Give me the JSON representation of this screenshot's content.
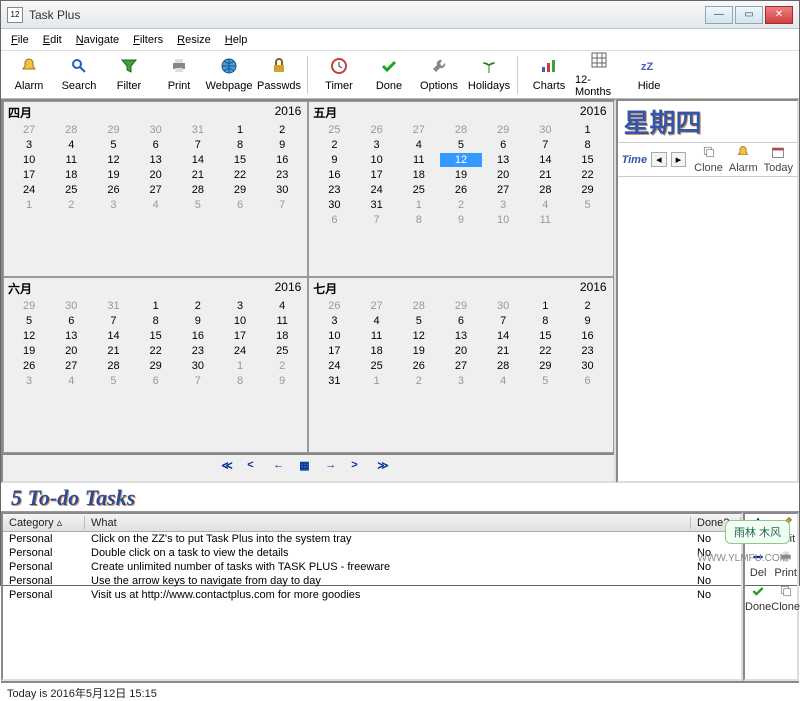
{
  "window": {
    "title": "Task Plus",
    "icon_text": "12"
  },
  "menubar": [
    "File",
    "Edit",
    "Navigate",
    "Filters",
    "Resize",
    "Help"
  ],
  "toolbar": [
    {
      "label": "Alarm",
      "icon": "bell"
    },
    {
      "label": "Search",
      "icon": "search"
    },
    {
      "label": "Filter",
      "icon": "filter"
    },
    {
      "label": "Print",
      "icon": "printer"
    },
    {
      "label": "Webpage",
      "icon": "globe"
    },
    {
      "label": "Passwds",
      "icon": "lock"
    },
    {
      "sep": true
    },
    {
      "label": "Timer",
      "icon": "clock"
    },
    {
      "label": "Done",
      "icon": "check"
    },
    {
      "label": "Options",
      "icon": "wrench"
    },
    {
      "label": "Holidays",
      "icon": "palm"
    },
    {
      "sep": true
    },
    {
      "label": "Charts",
      "icon": "chart"
    },
    {
      "label": "12-Months",
      "icon": "grid"
    },
    {
      "label": "Hide",
      "icon": "zz"
    }
  ],
  "calendars": [
    {
      "title": "四月",
      "year": "2016",
      "pre": [
        27,
        28,
        29,
        30,
        31
      ],
      "days": [
        1,
        2,
        3,
        4,
        5,
        6,
        7,
        8,
        9,
        10,
        11,
        12,
        13,
        14,
        15,
        16,
        17,
        18,
        19,
        20,
        21,
        22,
        23,
        24,
        25,
        26,
        27,
        28,
        29,
        30
      ],
      "post": [
        1,
        2,
        3,
        4,
        5,
        6,
        7
      ]
    },
    {
      "title": "五月",
      "year": "2016",
      "pre": [
        25,
        26,
        27,
        28,
        29,
        30
      ],
      "days": [
        1,
        2,
        3,
        4,
        5,
        6,
        7,
        8,
        9,
        10,
        11,
        12,
        13,
        14,
        15,
        16,
        17,
        18,
        19,
        20,
        21,
        22,
        23,
        24,
        25,
        26,
        27,
        28,
        29,
        30,
        31
      ],
      "post": [
        1,
        2,
        3,
        4,
        5,
        6,
        7,
        8,
        9,
        10,
        11
      ],
      "selected": 12
    },
    {
      "title": "六月",
      "year": "2016",
      "pre": [
        29,
        30,
        31
      ],
      "days": [
        1,
        2,
        3,
        4,
        5,
        6,
        7,
        8,
        9,
        10,
        11,
        12,
        13,
        14,
        15,
        16,
        17,
        18,
        19,
        20,
        21,
        22,
        23,
        24,
        25,
        26,
        27,
        28,
        29,
        30
      ],
      "post": [
        1,
        2,
        3,
        4,
        5,
        6,
        7,
        8,
        9
      ]
    },
    {
      "title": "七月",
      "year": "2016",
      "pre": [
        26,
        27,
        28,
        29,
        30
      ],
      "days": [
        1,
        2,
        3,
        4,
        5,
        6,
        7,
        8,
        9,
        10,
        11,
        12,
        13,
        14,
        15,
        16,
        17,
        18,
        19,
        20,
        21,
        22,
        23,
        24,
        25,
        26,
        27,
        28,
        29,
        30,
        31
      ],
      "post": [
        1,
        2,
        3,
        4,
        5,
        6
      ]
    }
  ],
  "rightpane": {
    "day_header": "星期四",
    "time_label": "Time",
    "tools": [
      {
        "label": "Clone",
        "icon": "clone"
      },
      {
        "label": "Alarm",
        "icon": "bell"
      },
      {
        "label": "Today",
        "icon": "cal"
      }
    ]
  },
  "todo_header": "5 To-do Tasks",
  "table": {
    "cols": {
      "category": "Category",
      "what": "What",
      "done": "Done?"
    },
    "rows": [
      {
        "cat": "Personal",
        "what": "Click on the ZZ's to put Task Plus into the system tray",
        "done": "No"
      },
      {
        "cat": "Personal",
        "what": "Double click on a task to view the details",
        "done": "No"
      },
      {
        "cat": "Personal",
        "what": "Create unlimited number of tasks with TASK PLUS - freeware",
        "done": "No"
      },
      {
        "cat": "Personal",
        "what": "Use the arrow keys to navigate from day to day",
        "done": "No"
      },
      {
        "cat": "Personal",
        "what": "Visit us at http://www.contactplus.com for more goodies",
        "done": "No"
      }
    ]
  },
  "sidetools": [
    {
      "label": "Add",
      "icon": "plus",
      "color": "#003399"
    },
    {
      "label": "Edit",
      "icon": "pencil",
      "color": "#888"
    },
    {
      "label": "Del",
      "icon": "minus",
      "color": "#003399"
    },
    {
      "label": "Print",
      "icon": "printer",
      "color": "#888"
    },
    {
      "label": "Done",
      "icon": "check",
      "color": "#c00000"
    },
    {
      "label": "Clone",
      "icon": "clone",
      "color": "#888"
    }
  ],
  "status": "Today is 2016年5月12日 15:15",
  "watermark_box": "雨林 木风",
  "watermark_url": "WWW.YLMFU.COM"
}
